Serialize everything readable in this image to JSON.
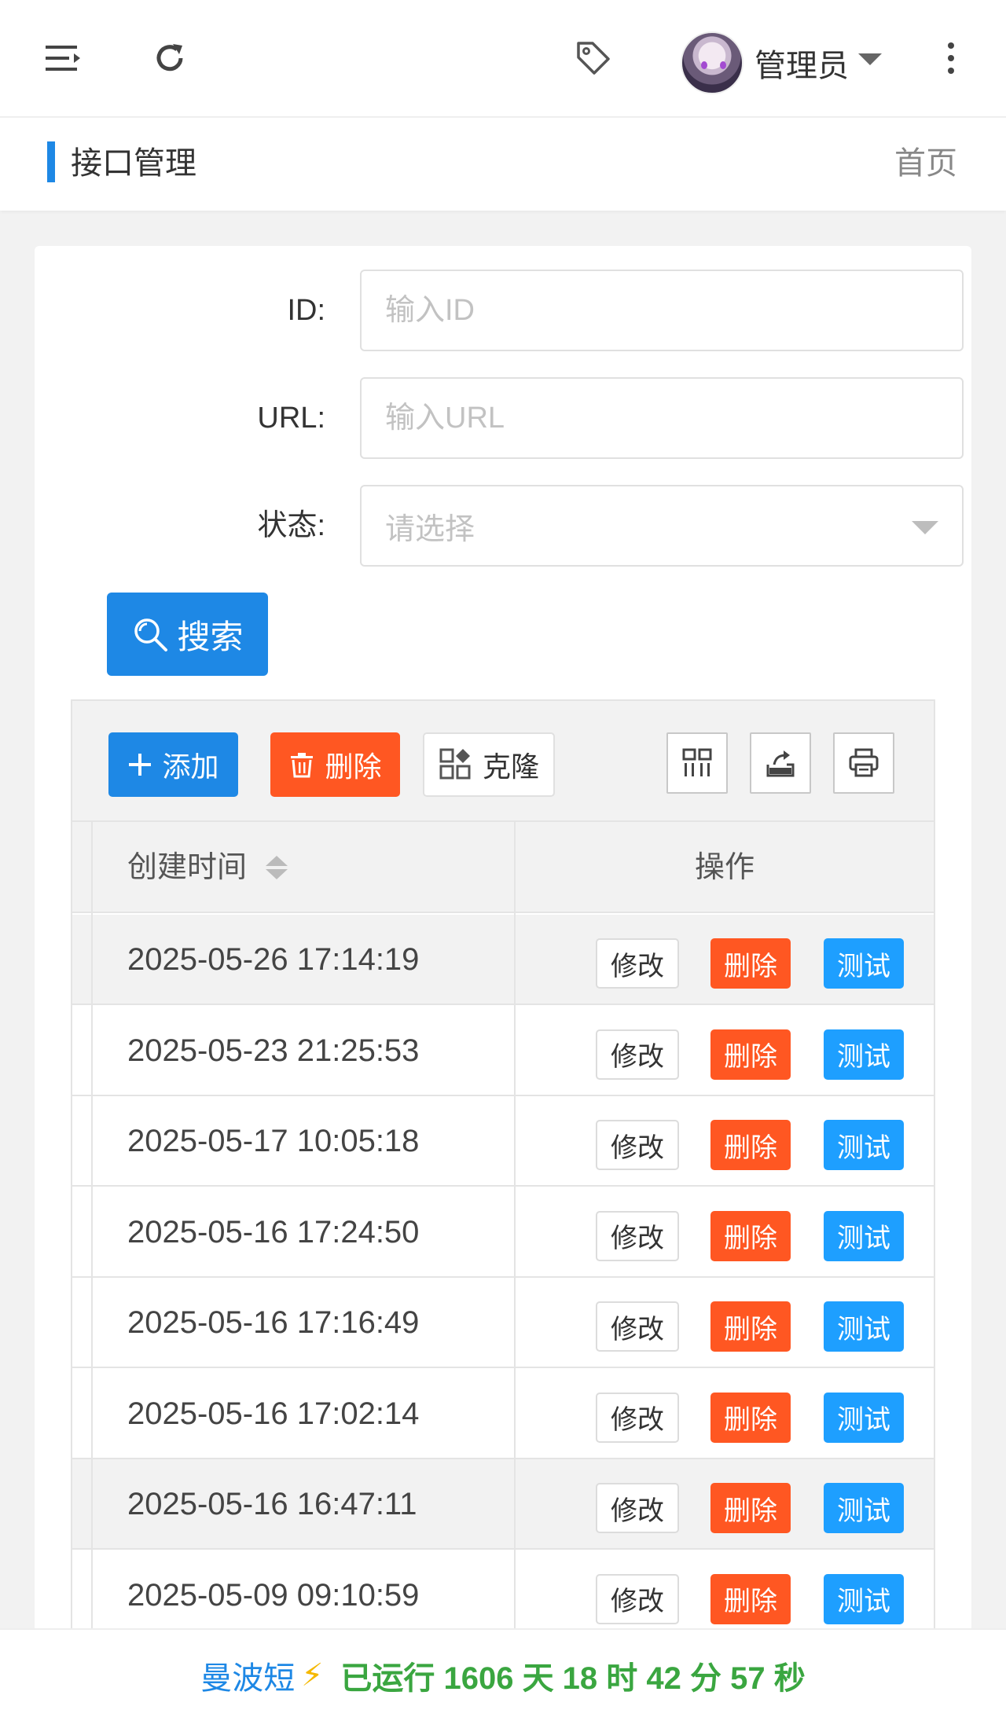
{
  "topbar": {
    "username": "管理员"
  },
  "breadcrumb": {
    "title": "接口管理",
    "home": "首页"
  },
  "form": {
    "id_label": "ID:",
    "id_placeholder": "输入ID",
    "url_label": "URL:",
    "url_placeholder": "输入URL",
    "status_label": "状态:",
    "status_placeholder": "请选择",
    "search_label": "搜索"
  },
  "toolbar": {
    "add_label": "添加",
    "delete_label": "删除",
    "clone_label": "克隆"
  },
  "table": {
    "col_created": "创建时间",
    "col_actions": "操作",
    "edit_label": "修改",
    "delete_label": "删除",
    "test_label": "测试",
    "rows": [
      "2025-05-26 17:14:19",
      "2025-05-23 21:25:53",
      "2025-05-17 10:05:18",
      "2025-05-16 17:24:50",
      "2025-05-16 17:16:49",
      "2025-05-16 17:02:14",
      "2025-05-16 16:47:11",
      "2025-05-09 09:10:59"
    ]
  },
  "footer": {
    "brand": "曼波短",
    "bolt": "⚡",
    "uptime": "已运行 1606 天 18 时 42 分 57 秒"
  },
  "colors": {
    "primary": "#1e88e5",
    "danger": "#ff5722",
    "test": "#1e9fff",
    "uptime": "#3aa640"
  }
}
